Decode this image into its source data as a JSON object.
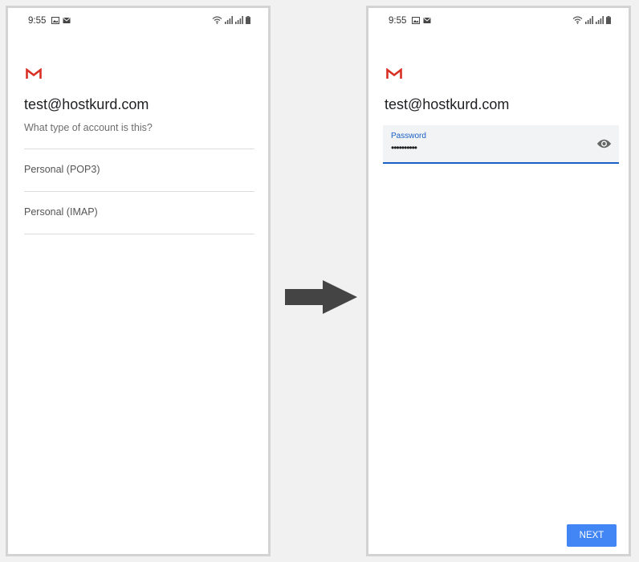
{
  "left_screen": {
    "status_bar": {
      "time": "9:55"
    },
    "account_email": "test@hostkurd.com",
    "question": "What type of account is this?",
    "options": [
      {
        "label": "Personal (POP3)"
      },
      {
        "label": "Personal (IMAP)"
      }
    ]
  },
  "right_screen": {
    "status_bar": {
      "time": "9:55"
    },
    "account_email": "test@hostkurd.com",
    "password_field": {
      "label": "Password",
      "value": "••••••••••"
    },
    "next_button": "NEXT"
  },
  "colors": {
    "accent": "#1a5fc6",
    "next_button": "#4285f4",
    "gmail_red": "#d93025",
    "arrow": "#444444",
    "frame_border": "#d3d3d3"
  },
  "icons": [
    "gmail-logo-icon",
    "eye-icon",
    "wifi-icon",
    "signal-icon",
    "battery-icon",
    "image-notification-icon",
    "mail-notification-icon",
    "right-arrow-icon"
  ]
}
